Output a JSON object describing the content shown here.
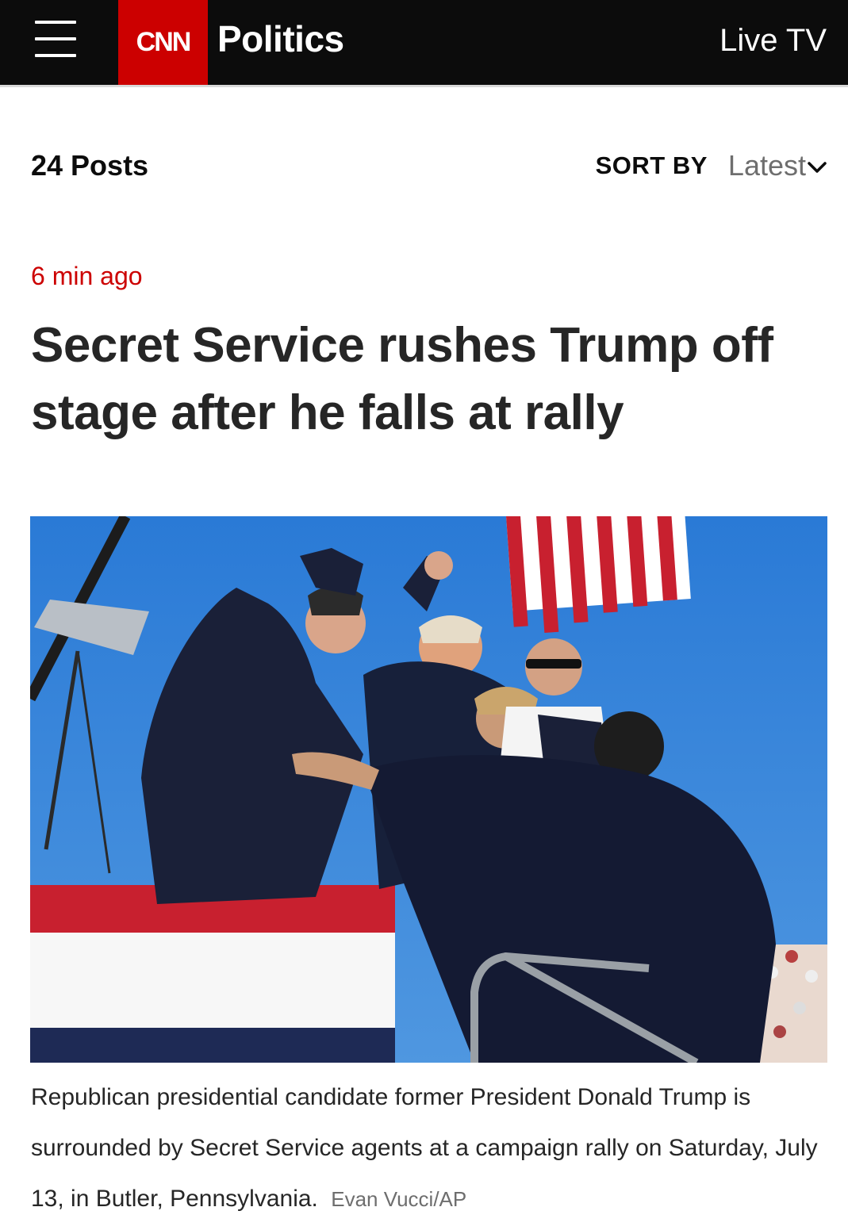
{
  "header": {
    "logo_text": "CNN",
    "section": "Politics",
    "live_tv": "Live TV",
    "colors": {
      "bar": "#0c0c0c",
      "brand_red": "#cc0000"
    }
  },
  "feed": {
    "posts_count": "24 Posts",
    "sort_label": "SORT BY",
    "sort_value": "Latest"
  },
  "post": {
    "timestamp": "6 min ago",
    "headline": "Secret Service rushes Trump off stage after he falls at rally",
    "caption": "Republican presidential candidate former President Donald Trump is surrounded by Secret Service agents at a campaign rally on Saturday, July 13, in Butler, Pennsylvania.",
    "credit": "Evan Vucci/AP"
  }
}
